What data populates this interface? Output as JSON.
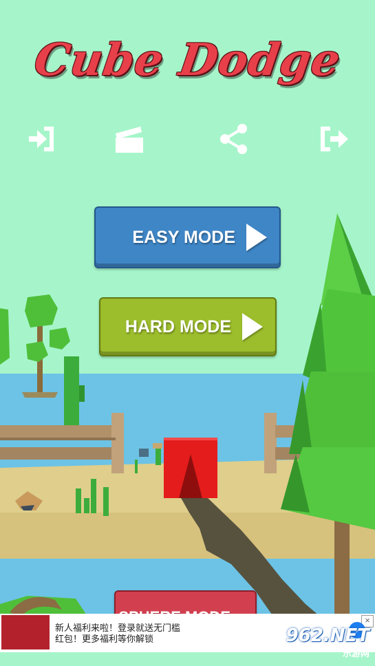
{
  "game": {
    "title": "Cube Dodge"
  },
  "toolbar": {
    "icons": [
      "enter-icon",
      "clapperboard-icon",
      "share-icon",
      "exit-icon"
    ]
  },
  "menu": {
    "easy_label": "EASY MODE",
    "hard_label": "HARD MODE",
    "sphere_label": "SPHERE MODE"
  },
  "colors": {
    "sky": "#a6f5ca",
    "water": "#6cc3e6",
    "sand": "#dfce8c",
    "title_red": "#e8404a",
    "easy_blue": "#3f86c6",
    "hard_green": "#9cbd2c",
    "sphere_red": "#d2404f",
    "cube_red": "#e51c1c",
    "tree_green": "#4fbf3a"
  },
  "ad": {
    "line1": "新人福利来啦！登录就送无门槛",
    "line2": "红包！更多福利等你解锁"
  },
  "watermark": {
    "brand": "962.NET",
    "site": "乐游网"
  }
}
